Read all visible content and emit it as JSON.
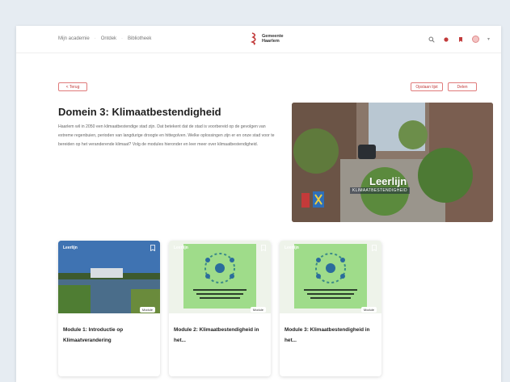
{
  "header": {
    "nav": [
      "Mijn academie",
      "Ontdek",
      "Bibliotheek"
    ],
    "logo_line1": "Gemeente",
    "logo_line2": "Haarlem"
  },
  "actions": {
    "back": "< Terug",
    "bookmark": "Opslaan lijst",
    "share": "Delen"
  },
  "page": {
    "title": "Domein 3: Klimaatbestendigheid",
    "description": "Haarlem wil in 2050 een klimaatbestendige stad zijn. Dat betekent dat de stad is voorbereid op de gevolgen van extreme regenbuien, perioden van langdurige droogte en hittegolven. Welke oplossingen zijn er en onze stad voor te bereiden op het veranderende klimaat? Volg de modules hieronder en leer meer over klimaatbestendigheid."
  },
  "hero": {
    "label": "Leerlijn",
    "subtitle": "KLIMAATBESTENDIGHEID"
  },
  "cards": [
    {
      "tag": "Leerlijn",
      "badge": "Module",
      "title": "Module 1: Introductie op Klimaatverandering"
    },
    {
      "tag": "Leerlijn",
      "badge": "Module",
      "title": "Module 2: Klimaatbestendigheid in het..."
    },
    {
      "tag": "Leerlijn",
      "badge": "Module",
      "title": "Module 3: Klimaatbestendigheid in het..."
    }
  ],
  "colors": {
    "accent": "#c23b3b",
    "card_green": "#9fdc8a"
  }
}
